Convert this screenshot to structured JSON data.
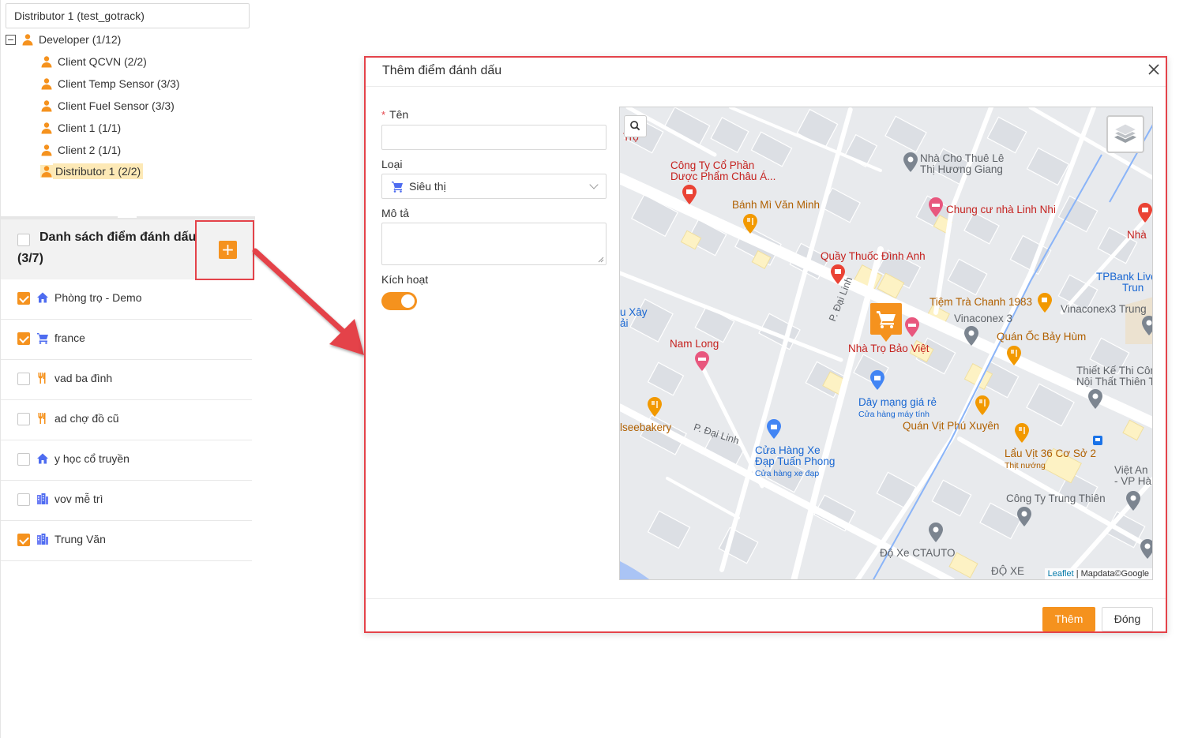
{
  "sidebar": {
    "distributor_select": "Distributor 1 (test_gotrack)",
    "tree": {
      "root": {
        "label": "Developer (1/12)",
        "toggle": "−"
      },
      "children": [
        {
          "label": "Client QCVN (2/2)"
        },
        {
          "label": "Client Temp Sensor (3/3)"
        },
        {
          "label": "Client Fuel Sensor (3/3)"
        },
        {
          "label": "Client 1 (1/1)"
        },
        {
          "label": "Client 2 (1/1)"
        },
        {
          "label": "Distributor 1 (2/2)",
          "selected": true
        }
      ]
    },
    "marker_list": {
      "title": "Danh sách điểm đánh dấu",
      "count": "(3/7)",
      "add_button": "+",
      "items": [
        {
          "label": "Phòng trọ - Demo",
          "checked": true,
          "icon": "home-icon"
        },
        {
          "label": "france",
          "checked": true,
          "icon": "cart-icon"
        },
        {
          "label": "vad ba đình",
          "checked": false,
          "icon": "restaurant-icon"
        },
        {
          "label": "ad chợ đồ cũ",
          "checked": false,
          "icon": "restaurant-icon"
        },
        {
          "label": "y học cổ truyền",
          "checked": false,
          "icon": "home-icon"
        },
        {
          "label": "vov mễ trì",
          "checked": false,
          "icon": "building-icon"
        },
        {
          "label": "Trung Văn",
          "checked": true,
          "icon": "building-icon"
        }
      ]
    }
  },
  "modal": {
    "title": "Thêm điểm đánh dấu",
    "close": "X",
    "form": {
      "name_label": "Tên",
      "name_required_mark": "*",
      "name_value": "",
      "type_label": "Loại",
      "type_value": "Siêu thị",
      "type_icon": "cart-icon",
      "description_label": "Mô tả",
      "description_value": "",
      "active_label": "Kích hoạt",
      "active": true
    },
    "buttons": {
      "submit": "Thêm",
      "close": "Đóng"
    }
  },
  "map": {
    "pois": [
      {
        "id": "p1",
        "text": "Công Ty Cổ Phần",
        "text2": "Dược Phẩm Châu Á...",
        "color": "red"
      },
      {
        "id": "p2",
        "text": "Nhà Cho Thuê Lê",
        "text2": "Thị Hương Giang",
        "color": "gry"
      },
      {
        "id": "p3",
        "text": "Bánh Mì Văn Minh",
        "color": "org"
      },
      {
        "id": "p4",
        "text": "Chung cư nhà Linh Nhi",
        "color": "red"
      },
      {
        "id": "p5",
        "text": "Quầy Thuốc Đình Anh",
        "color": "red"
      },
      {
        "id": "p6",
        "text": "TPBank Live",
        "text2": "Trun",
        "color": "blu"
      },
      {
        "id": "p7",
        "text": "Tiệm Trà Chanh 1983",
        "color": "org"
      },
      {
        "id": "p8",
        "text": "Vinaconex3 Trung",
        "color": "gry"
      },
      {
        "id": "p9",
        "text": "Vinaconex 3",
        "color": "gry"
      },
      {
        "id": "p10",
        "text": "Quán Ốc Bảy Hùm",
        "color": "org"
      },
      {
        "id": "p11",
        "text": "Nhà Trọ Bảo Việt",
        "color": "red"
      },
      {
        "id": "p12",
        "text": "Nam Long",
        "color": "red"
      },
      {
        "id": "p13",
        "text": "Thiết Kế Thi Côn",
        "text2": "Nội Thất Thiên T",
        "color": "gry"
      },
      {
        "id": "p14",
        "text": "Dây mạng giá rẻ",
        "sub": "Cửa hàng máy tính",
        "color": "blu"
      },
      {
        "id": "p15",
        "text": "Quán Vịt Phú Xuyên",
        "color": "org"
      },
      {
        "id": "p16",
        "text": "lseebakery",
        "color": "org"
      },
      {
        "id": "p17",
        "text": "Cửa Hàng Xe",
        "text2": "Đạp Tuấn Phong",
        "sub": "Cửa hàng xe đạp",
        "color": "blu"
      },
      {
        "id": "p18",
        "text": "Lẩu Vịt 36 Cơ Sở 2",
        "sub": "Thịt nướng",
        "color": "org"
      },
      {
        "id": "p19",
        "text": "Việt An",
        "text2": "- VP Hà",
        "color": "gry"
      },
      {
        "id": "p20",
        "text": "Công Ty Trung Thiên",
        "color": "gry"
      },
      {
        "id": "p21",
        "text": "Độ Xe CTAUTO",
        "color": "gry"
      },
      {
        "id": "p22",
        "text": "ĐỘ XE",
        "color": "gry"
      },
      {
        "id": "p23",
        "text": "u Xây",
        "text2": "ải",
        "color": "blu"
      },
      {
        "id": "p24",
        "text": "Nhà",
        "color": "red"
      },
      {
        "id": "p25",
        "text": "Trọ",
        "color": "red"
      }
    ],
    "streets": [
      {
        "id": "s1",
        "text": "P. Đại Linh"
      },
      {
        "id": "s2",
        "text": "P. Đại Linh"
      }
    ],
    "attribution": {
      "link": "Leaflet",
      "text": "| Mapdata©Google"
    }
  },
  "colors": {
    "accent": "#f5921e",
    "highlight": "#e4434a",
    "selected_bg": "#fde9b6"
  }
}
